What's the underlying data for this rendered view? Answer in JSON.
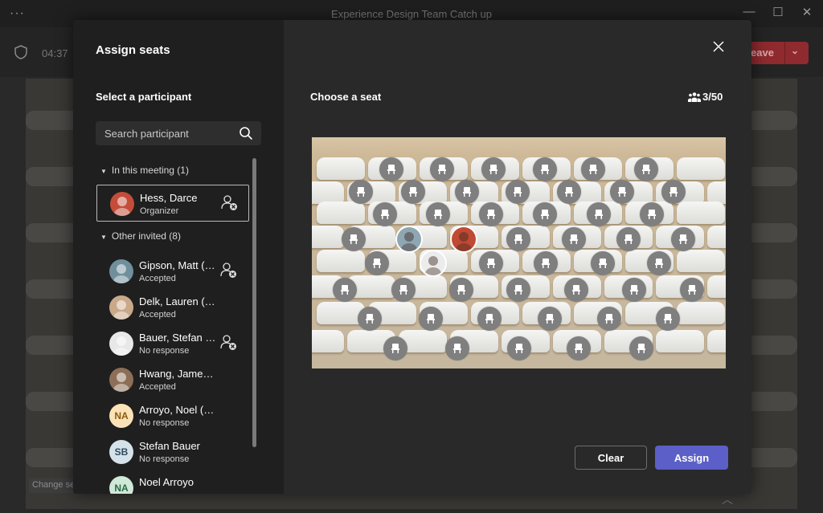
{
  "window": {
    "title": "Experience Design Team Catch up",
    "more": "···",
    "minimize": "—",
    "maximize": "☐",
    "close": "✕"
  },
  "toolbar": {
    "timer": "04:37",
    "leave_label": "eave",
    "leave_chevron": "⌄"
  },
  "background": {
    "change_seat_label": "Change se"
  },
  "dialog": {
    "title": "Assign seats",
    "select_label": "Select a participant",
    "search_placeholder": "Search participant",
    "sections": {
      "in_meeting": "In this meeting (1)",
      "other_invited": "Other invited (8)"
    },
    "participants": [
      {
        "name": "Hess, Darce",
        "status": "Organizer",
        "initials": "",
        "avatar_color": "#c44d3a",
        "selected": true
      },
      {
        "name": "Gipson, Matt (…",
        "status": "Accepted",
        "initials": "",
        "avatar_color": "#6f8f9c"
      },
      {
        "name": "Delk, Lauren (ext)",
        "status": "Accepted",
        "initials": "",
        "avatar_color": "#c9a98a"
      },
      {
        "name": "Bauer, Stefan 1…",
        "status": "No response",
        "initials": "",
        "avatar_color": "#e8e8e8"
      },
      {
        "name": "Hwang, James (ext)",
        "status": "Accepted",
        "initials": "",
        "avatar_color": "#8c6f56"
      },
      {
        "name": "Arroyo, Noel (ext)",
        "status": "No response",
        "initials": "NA",
        "avatar_color": "#fce3b7",
        "text_color": "#8a5a10"
      },
      {
        "name": "Stefan Bauer",
        "status": "No response",
        "initials": "SB",
        "avatar_color": "#d6e2ea",
        "text_color": "#2f4a5e"
      },
      {
        "name": "Noel Arroyo",
        "status": "",
        "initials": "NA",
        "avatar_color": "#cfe8d8",
        "text_color": "#2a6a44"
      }
    ],
    "choose_label": "Choose a seat",
    "seat_count": "3/50",
    "clear_label": "Clear",
    "assign_label": "Assign"
  },
  "colors": {
    "accent": "#5b5fc7",
    "leave": "#8f2a2f",
    "seat_empty": "#7f7f7f"
  },
  "icons": [
    "more-icon",
    "shield-icon",
    "search-icon",
    "remove-person-icon",
    "close-icon",
    "people-icon",
    "chair-icon",
    "chevron-down-icon"
  ]
}
